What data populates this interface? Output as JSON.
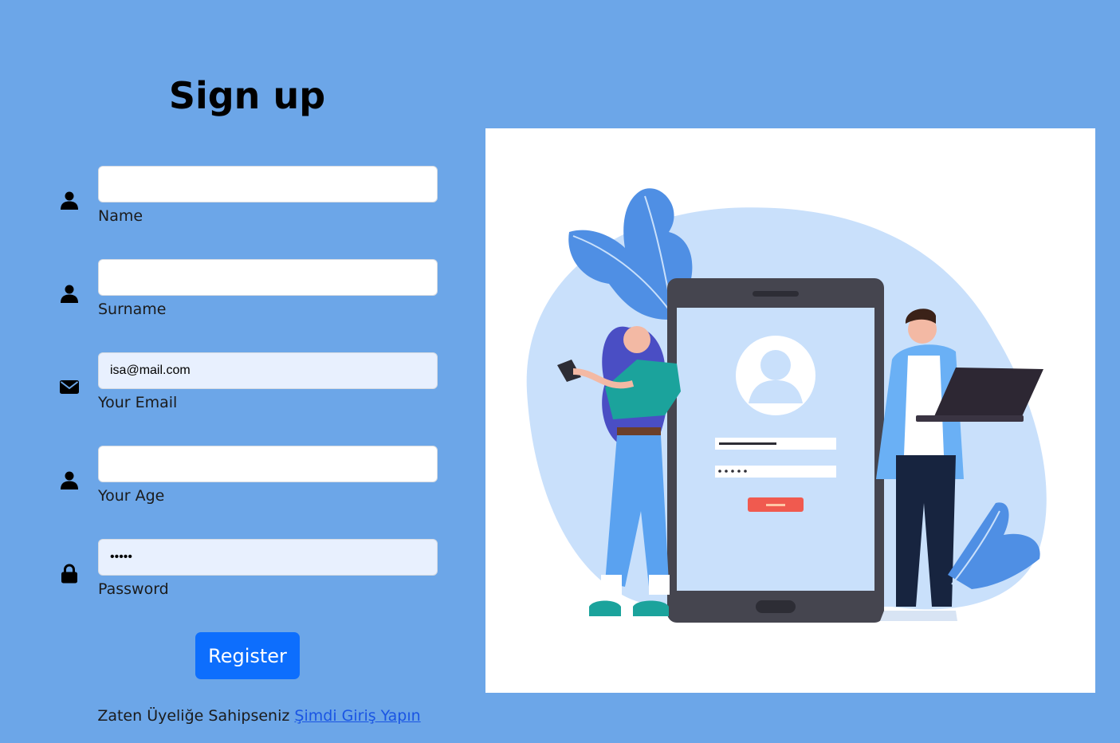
{
  "title": "Sign up",
  "form": {
    "fields": [
      {
        "label": "Name",
        "value": "",
        "placeholder": "",
        "type": "text",
        "icon": "user-icon"
      },
      {
        "label": "Surname",
        "value": "",
        "placeholder": "",
        "type": "text",
        "icon": "user-icon"
      },
      {
        "label": "Your Email",
        "value": "isa@mail.com",
        "placeholder": "",
        "type": "email",
        "icon": "envelope-icon"
      },
      {
        "label": "Your Age",
        "value": "",
        "placeholder": "",
        "type": "text",
        "icon": "user-icon"
      },
      {
        "label": "Password",
        "value": "•••••",
        "placeholder": "",
        "type": "password",
        "icon": "lock-icon"
      }
    ],
    "register_label": "Register",
    "login_prompt": "Zaten Üyeliğe Sahipseniz",
    "login_link": "Şimdi Giriş Yapın"
  },
  "colors": {
    "background": "#6ca6e8",
    "button": "#0d6efd",
    "autofill": "#e8f0fe"
  }
}
